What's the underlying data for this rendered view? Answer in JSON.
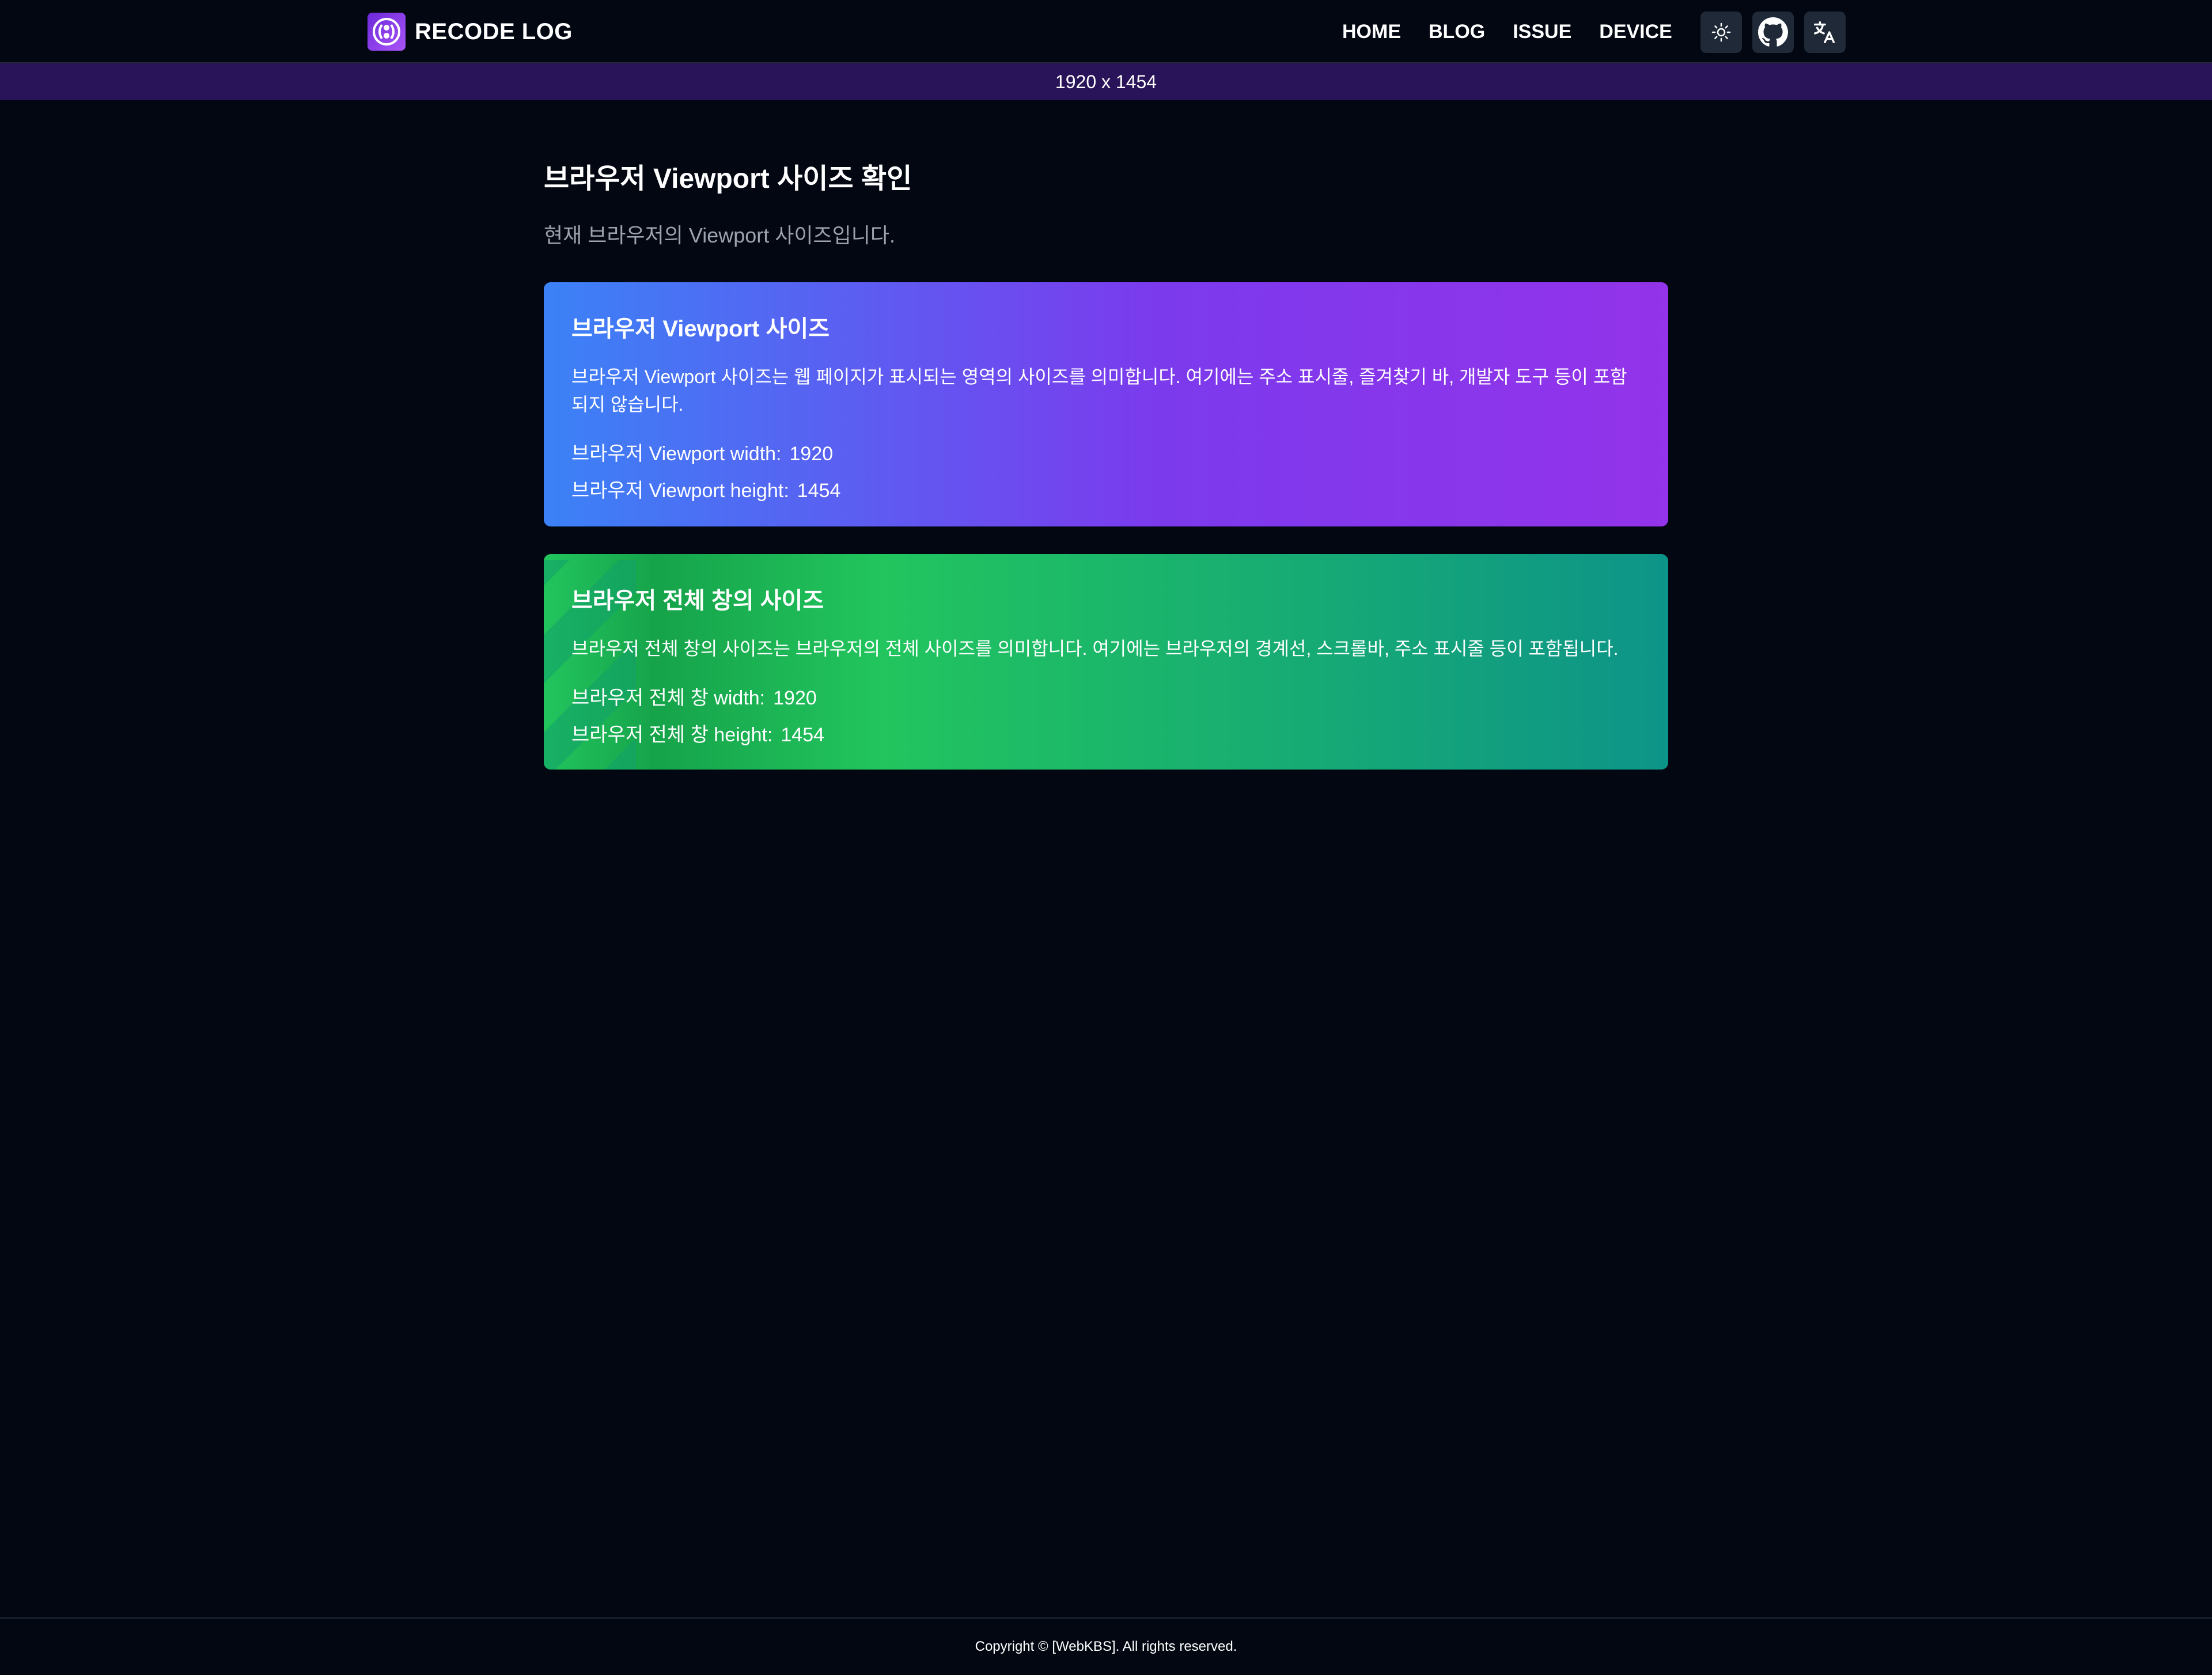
{
  "header": {
    "brand": "RECODE LOG",
    "nav": [
      "HOME",
      "BLOG",
      "ISSUE",
      "DEVICE"
    ],
    "icons": [
      "sun-icon",
      "github-icon",
      "translate-icon"
    ]
  },
  "size_bar": {
    "text": "1920 x 1454"
  },
  "main": {
    "title": "브라우저 Viewport 사이즈 확인",
    "subtitle": "현재 브라우저의 Viewport 사이즈입니다.",
    "viewport_card": {
      "title": "브라우저 Viewport 사이즈",
      "description": "브라우저 Viewport 사이즈는 웹 페이지가 표시되는 영역의 사이즈를 의미합니다. 여기에는 주소 표시줄, 즐겨찾기 바, 개발자 도구 등이 포함되지 않습니다.",
      "width_label": "브라우저 Viewport width:",
      "width_value": "1920",
      "height_label": "브라우저 Viewport height:",
      "height_value": "1454"
    },
    "window_card": {
      "title": "브라우저 전체 창의 사이즈",
      "description": "브라우저 전체 창의 사이즈는 브라우저의 전체 사이즈를 의미합니다. 여기에는 브라우저의 경계선, 스크롤바, 주소 표시줄 등이 포함됩니다.",
      "width_label": "브라우저 전체 창 width:",
      "width_value": "1920",
      "height_label": "브라우저 전체 창 height:",
      "height_value": "1454"
    }
  },
  "footer": {
    "text": "Copyright © [WebKBS]. All rights reserved."
  },
  "colors": {
    "background": "#030712",
    "size_bar": "#2a1459",
    "viewport_card_start": "#3b82f6",
    "viewport_card_end": "#9333ea",
    "window_card_start": "#22c55e",
    "window_card_end": "#0d9488"
  }
}
